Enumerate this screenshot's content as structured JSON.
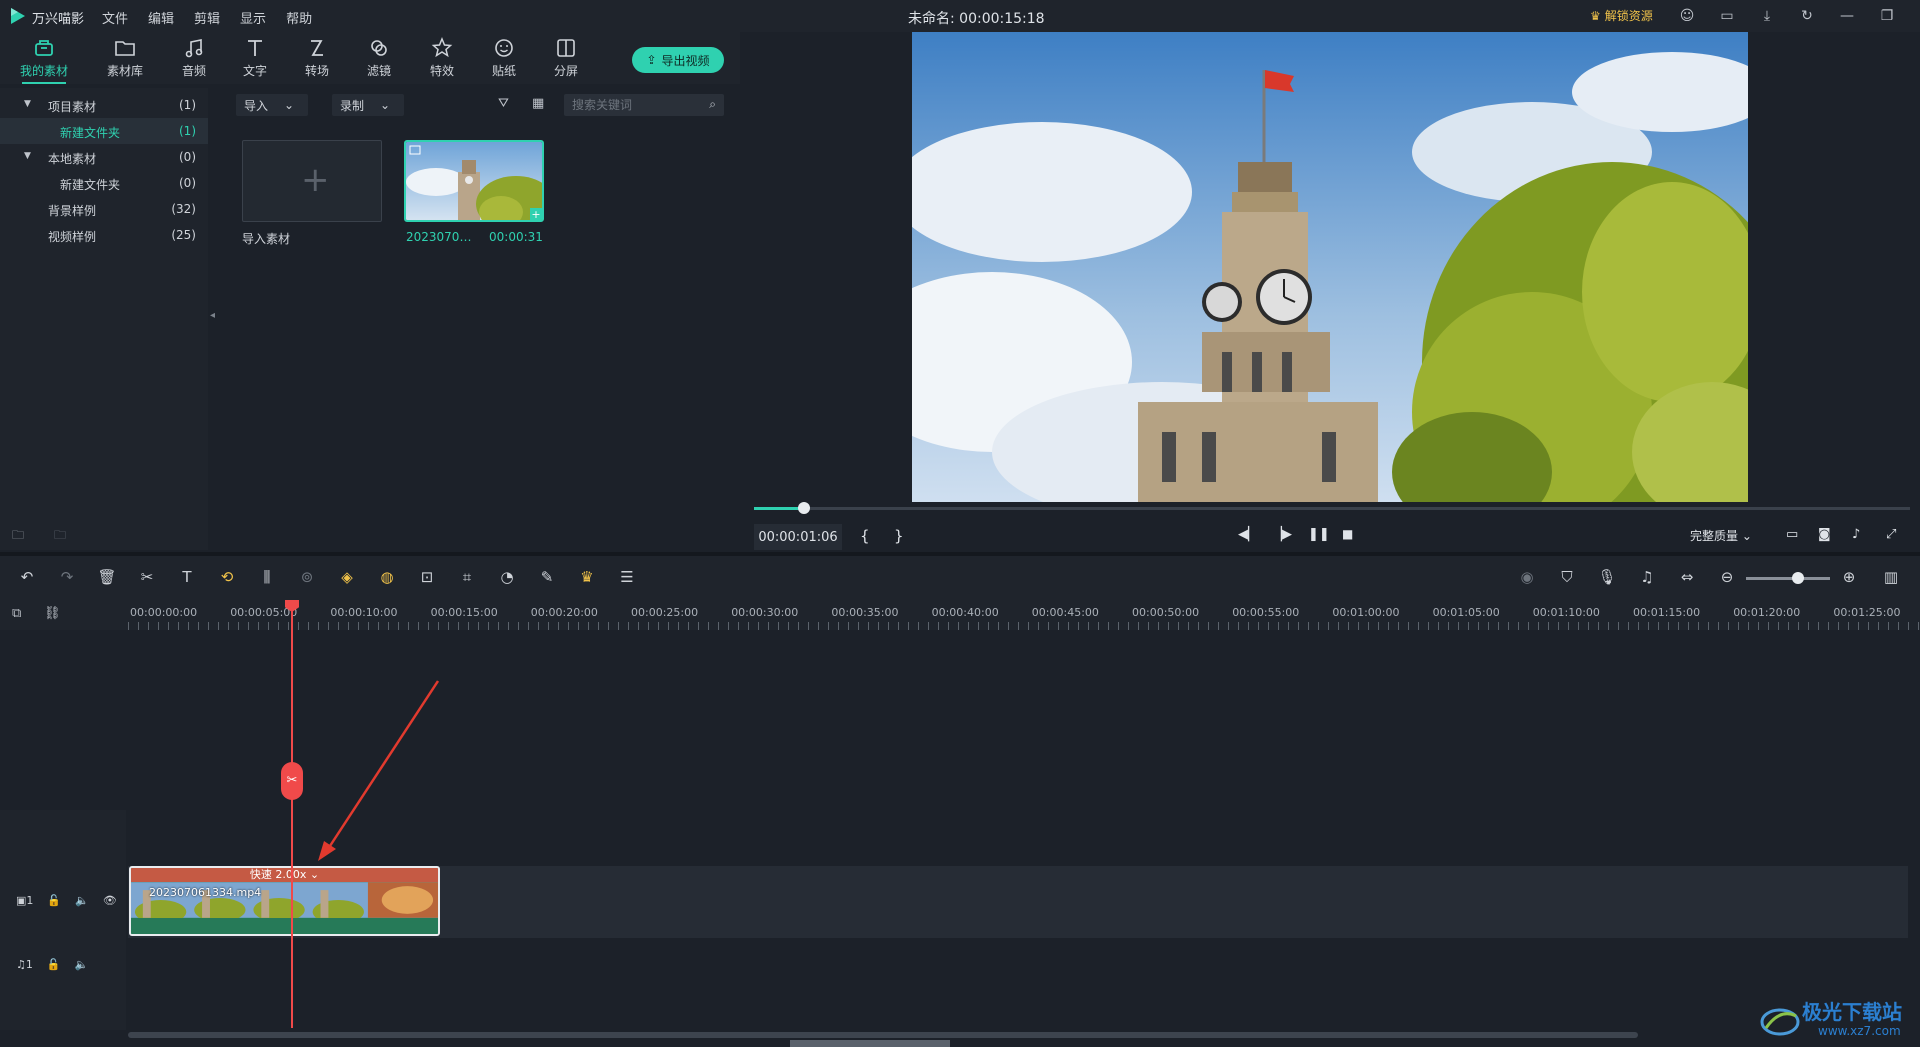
{
  "app": {
    "name": "万兴喵影",
    "project_title": "未命名: 00:00:15:18",
    "menu": [
      "文件",
      "编辑",
      "剪辑",
      "显示",
      "帮助"
    ],
    "unlock_label": "解锁资源"
  },
  "tabs": [
    {
      "label": "我的素材",
      "icon": "folder-box-icon",
      "active": true
    },
    {
      "label": "素材库",
      "icon": "folder-icon"
    },
    {
      "label": "音频",
      "icon": "music-note-icon"
    },
    {
      "label": "文字",
      "icon": "text-t-icon"
    },
    {
      "label": "转场",
      "icon": "transition-icon"
    },
    {
      "label": "滤镜",
      "icon": "filter-icon"
    },
    {
      "label": "特效",
      "icon": "effects-icon"
    },
    {
      "label": "贴纸",
      "icon": "sticker-icon"
    },
    {
      "label": "分屏",
      "icon": "split-screen-icon"
    }
  ],
  "export_button": "导出视频",
  "tree": [
    {
      "name": "项目素材",
      "count": "(1)",
      "expanded": true
    },
    {
      "name": "新建文件夹",
      "count": "(1)",
      "selected": true
    },
    {
      "name": "本地素材",
      "count": "(0)",
      "expanded": true
    },
    {
      "name": "新建文件夹",
      "count": "(0)"
    },
    {
      "name": "背景样例",
      "count": "(32)"
    },
    {
      "name": "视频样例",
      "count": "(25)"
    }
  ],
  "media_toolbar": {
    "import": "导入",
    "record": "录制",
    "search_placeholder": "搜索关键词"
  },
  "media_items": {
    "import_label": "导入素材",
    "clip_name": "2023070…",
    "clip_duration": "00:00:31"
  },
  "preview": {
    "timecode": "00:00:01:06",
    "progress": 0.04,
    "quality": "完整质量",
    "mark_in": "{",
    "mark_out": "}"
  },
  "ruler_labels": [
    "00:00:00:00",
    "00:00:05:00",
    "00:00:10:00",
    "00:00:15:00",
    "00:00:20:00",
    "00:00:25:00",
    "00:00:30:00",
    "00:00:35:00",
    "00:00:40:00",
    "00:00:45:00",
    "00:00:50:00",
    "00:00:55:00",
    "00:01:00:00",
    "00:01:05:00",
    "00:01:10:00",
    "00:01:15:00",
    "00:01:20:00",
    "00:01:25:00"
  ],
  "timeline": {
    "clip_speed": "快速 2.00x",
    "clip_name": "20230706133​4.mp4",
    "video_track_label": "1",
    "audio_track_label": "1"
  },
  "watermark": {
    "text": "极光下载站",
    "url": "www.xz7.com"
  },
  "colors": {
    "accent": "#2fd1b0",
    "playhead": "#f04a4a",
    "clip_header": "#c55a44"
  }
}
